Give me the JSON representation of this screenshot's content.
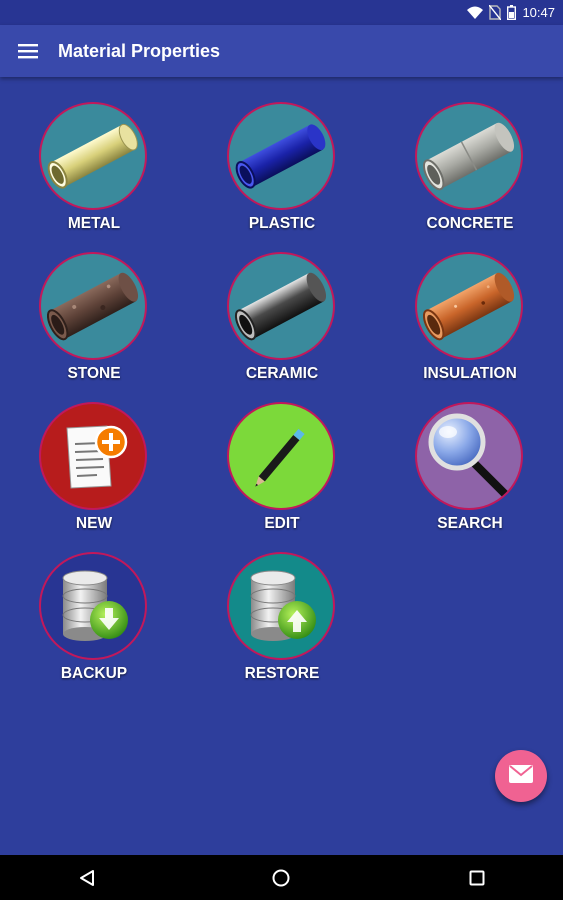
{
  "status_bar": {
    "time": "10:47",
    "icons": [
      "wifi-icon",
      "no-sim-icon",
      "battery-icon"
    ]
  },
  "app_bar": {
    "menu_icon": "hamburger-menu-icon",
    "title": "Material Properties"
  },
  "tiles": [
    {
      "label": "METAL",
      "icon": "metal-pipe-icon",
      "bg": "#3A8A9C"
    },
    {
      "label": "PLASTIC",
      "icon": "plastic-pipe-icon",
      "bg": "#3A8A9C"
    },
    {
      "label": "CONCRETE",
      "icon": "concrete-pipe-icon",
      "bg": "#3A8A9C"
    },
    {
      "label": "STONE",
      "icon": "stone-pipe-icon",
      "bg": "#3A8A9C"
    },
    {
      "label": "CERAMIC",
      "icon": "ceramic-pipe-icon",
      "bg": "#3A8A9C"
    },
    {
      "label": "INSULATION",
      "icon": "insulation-pipe-icon",
      "bg": "#3A8A9C"
    },
    {
      "label": "NEW",
      "icon": "new-document-icon",
      "bg": "#B71C1C"
    },
    {
      "label": "EDIT",
      "icon": "pencil-icon",
      "bg": "#7CD93A"
    },
    {
      "label": "SEARCH",
      "icon": "magnifier-icon",
      "bg": "#8E63A8"
    },
    {
      "label": "BACKUP",
      "icon": "database-download-icon",
      "bg": "#283593"
    },
    {
      "label": "RESTORE",
      "icon": "database-upload-icon",
      "bg": "#138A8A"
    }
  ],
  "fab": {
    "icon": "mail-icon",
    "color": "#F06292"
  },
  "nav_bar": {
    "back_icon": "back-icon",
    "home_icon": "home-icon",
    "recents_icon": "recents-icon"
  },
  "colors": {
    "background": "#2E3E9C",
    "app_bar": "#3949AB",
    "circle_border": "#C2185B"
  }
}
